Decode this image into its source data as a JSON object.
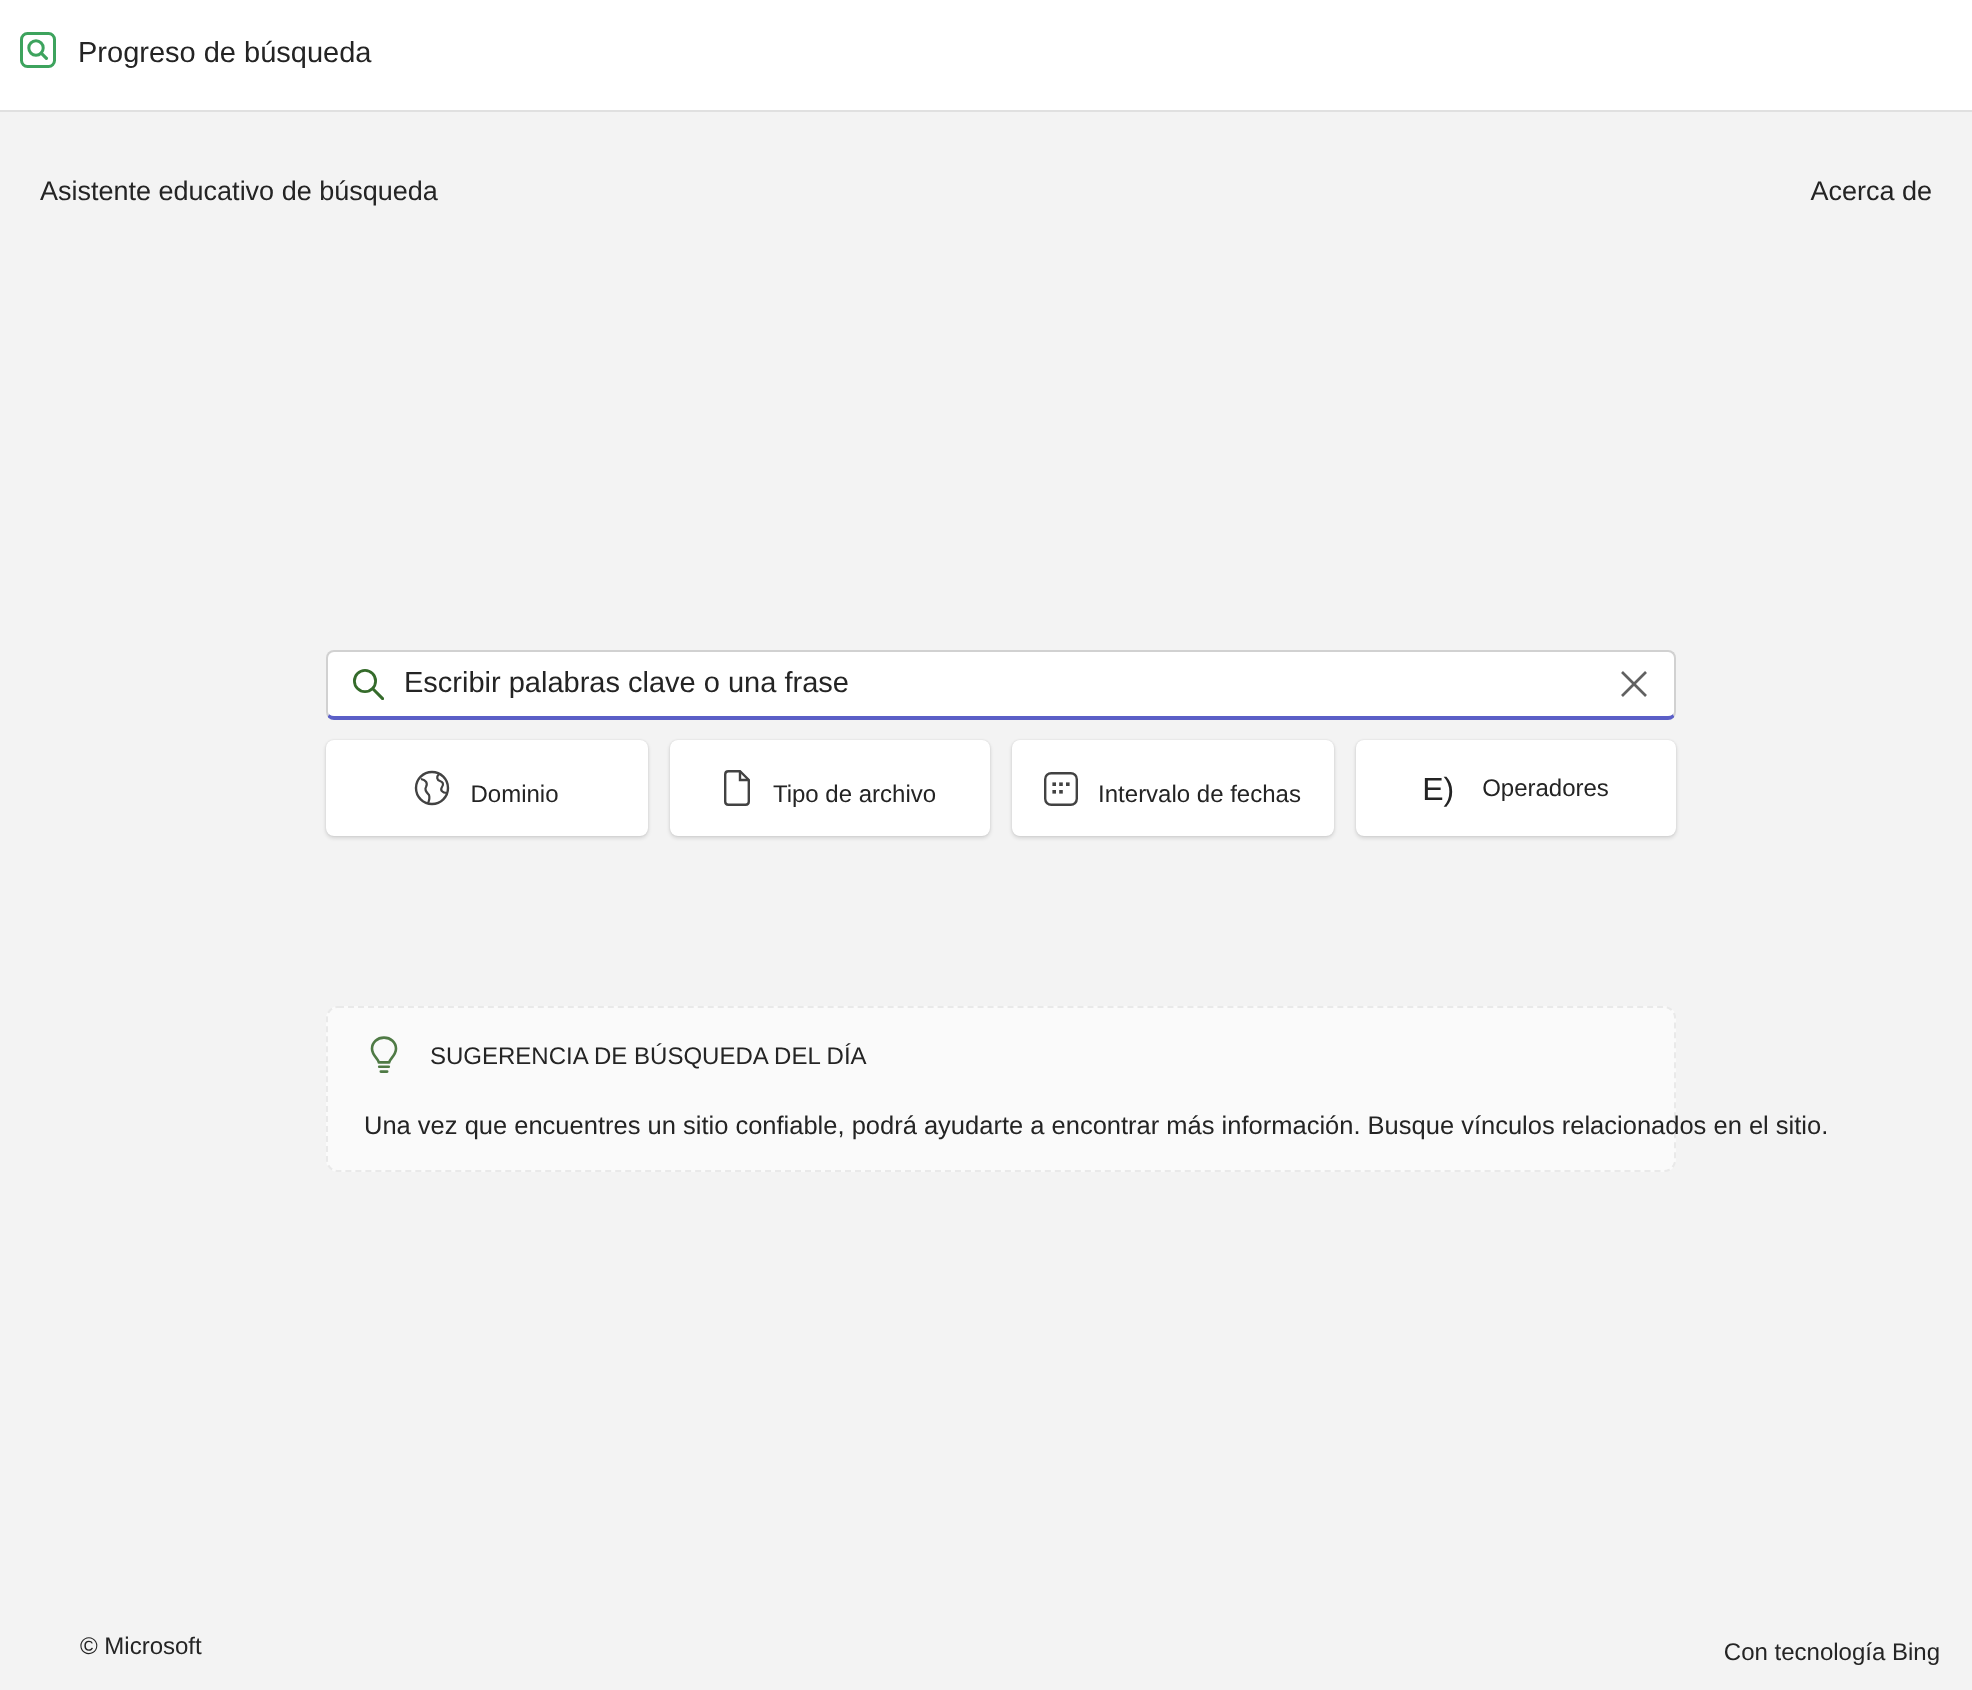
{
  "app_bar": {
    "title": "Progreso de búsqueda"
  },
  "nav": {
    "title": "Asistente educativo de búsqueda",
    "link": "Acerca de"
  },
  "search": {
    "placeholder": "Escribir palabras clave o una frase"
  },
  "filters": [
    {
      "kind": "globe",
      "label": "Dominio"
    },
    {
      "kind": "file",
      "label": "Tipo de archivo"
    },
    {
      "kind": "calendar",
      "label": "Intervalo de fechas"
    },
    {
      "kind": "glyph",
      "glyph": "E)",
      "label": "Operadores"
    }
  ],
  "tip": {
    "heading": "SUGERENCIA DE BÚSQUEDA DEL DÍA",
    "text": "Una vez que encuentres un sitio confiable, podrá ayudarte a encontrar más información. Busque vínculos relacionados en el sitio."
  },
  "footer": {
    "copyright": "© Microsoft",
    "powered_by": "Con tecnología Bing"
  }
}
